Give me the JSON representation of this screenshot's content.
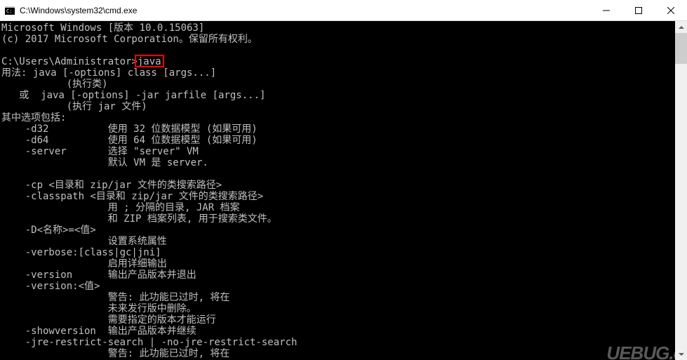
{
  "window": {
    "title": "C:\\Windows\\system32\\cmd.exe"
  },
  "terminal": {
    "lines": {
      "l0": "Microsoft Windows [版本 10.0.15063]",
      "l1": "(c) 2017 Microsoft Corporation。保留所有权利。",
      "l2": "",
      "l3_prompt": "C:\\Users\\Administrator>",
      "l3_cmd": "java",
      "l4": "用法: java [-options] class [args...]",
      "l5": "           (执行类)",
      "l6": "   或  java [-options] -jar jarfile [args...]",
      "l7": "           (执行 jar 文件)",
      "l8": "其中选项包括:",
      "l9": "    -d32          使用 32 位数据模型 (如果可用)",
      "l10": "    -d64          使用 64 位数据模型 (如果可用)",
      "l11": "    -server       选择 \"server\" VM",
      "l12": "                  默认 VM 是 server.",
      "l13": "",
      "l14": "    -cp <目录和 zip/jar 文件的类搜索路径>",
      "l15": "    -classpath <目录和 zip/jar 文件的类搜索路径>",
      "l16": "                  用 ; 分隔的目录, JAR 档案",
      "l17": "                  和 ZIP 档案列表, 用于搜索类文件。",
      "l18": "    -D<名称>=<值>",
      "l19": "                  设置系统属性",
      "l20": "    -verbose:[class|gc|jni]",
      "l21": "                  启用详细输出",
      "l22": "    -version      输出产品版本并退出",
      "l23": "    -version:<值>",
      "l24": "                  警告: 此功能已过时, 将在",
      "l25": "                  未来发行版中删除。",
      "l26": "                  需要指定的版本才能运行",
      "l27": "    -showversion  输出产品版本并继续",
      "l28": "    -jre-restrict-search | -no-jre-restrict-search",
      "l29": "                  警告: 此功能已过时, 将在"
    }
  },
  "highlight": {
    "target": "java"
  },
  "watermark": "UEBUG.c"
}
